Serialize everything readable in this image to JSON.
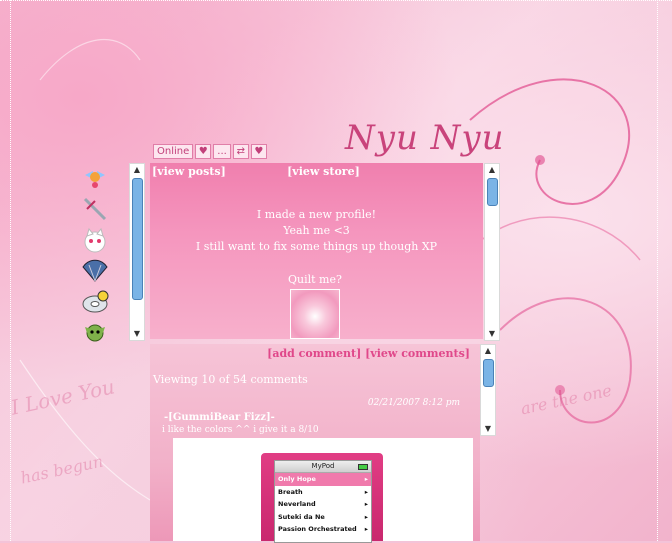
{
  "header": {
    "title": "Nyu Nyu",
    "tabs": [
      {
        "label": "Online",
        "icon": ""
      },
      {
        "label": "",
        "icon": "heart-icon"
      },
      {
        "label": "...",
        "icon": ""
      },
      {
        "label": "",
        "icon": "swap-arrows-icon"
      },
      {
        "label": "",
        "icon": "broken-heart-icon"
      }
    ]
  },
  "profile": {
    "links": [
      "[view posts]",
      "[view store]"
    ],
    "bio": [
      "I made a new profile!",
      "Yeah me <3",
      "I still want to fix some things up though XP"
    ],
    "quilt_label": "Quilt me?"
  },
  "icons": [
    "winged-character-icon",
    "sword-icon",
    "white-cat-icon",
    "fan-icon",
    "cd-icon",
    "green-creature-icon"
  ],
  "comments": {
    "links": [
      "[add comment]",
      "[view comments]"
    ],
    "viewing": "Viewing 10 of 54 comments",
    "date": "02/21/2007 8:12 pm",
    "author": "-[GummiBear Fizz]-",
    "text": "i like the colors ^^ i give it a 8/10"
  },
  "mypod": {
    "title": "MyPod",
    "items": [
      "Only Hope",
      "Breath",
      "Neverland",
      "Suteki da Ne",
      "Passion Orchestrated"
    ]
  },
  "colors": {
    "accent": "#c9437b",
    "link_hot": "#ff5aa0",
    "scroll_thumb": "#7ab4e6"
  }
}
